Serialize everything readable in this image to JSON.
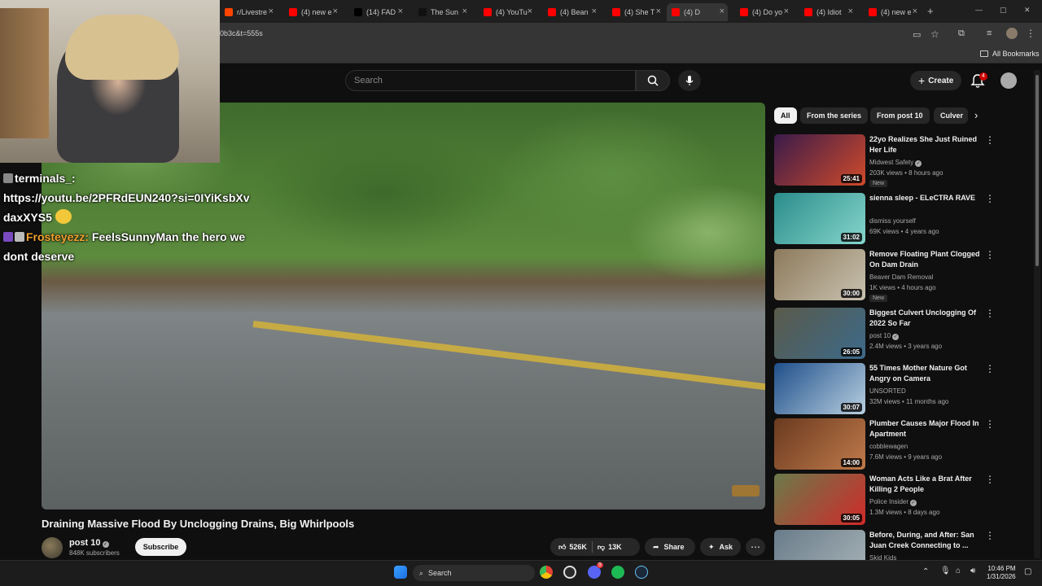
{
  "browser": {
    "tabs": [
      {
        "label": "r/Livestre",
        "color": "#ff4500"
      },
      {
        "label": "(4) new e",
        "color": "#ff0000"
      },
      {
        "label": "(14) FAD",
        "color": "#000000"
      },
      {
        "label": "The Sun",
        "color": "#111111"
      },
      {
        "label": "(4) YouTu",
        "color": "#ff0000"
      },
      {
        "label": "(4) Bean",
        "color": "#ff0000"
      },
      {
        "label": "(4) She T",
        "color": "#ff0000"
      },
      {
        "label": "(4) D",
        "color": "#ff0000"
      },
      {
        "label": "(4) Do yo",
        "color": "#ff0000"
      },
      {
        "label": "(4) Idiot",
        "color": "#ff0000"
      },
      {
        "label": "(4) new e",
        "color": "#ff0000"
      }
    ],
    "url": "0b3c&t=555s",
    "bookmarks_label": "All Bookmarks"
  },
  "youtube": {
    "search_placeholder": "Search",
    "create_label": "Create",
    "notification_count": "4"
  },
  "chat": {
    "messages": [
      {
        "user": "terminals_:",
        "text": "https://youtu.be/2PFRdEUN240?si=0IYiKsbXvdaxXYS5"
      },
      {
        "user": "Frosteyezz:",
        "text": "FeelsSunnyMan the hero we dont deserve"
      }
    ]
  },
  "video": {
    "title": "Draining Massive Flood By Unclogging Drains, Big Whirlpools",
    "channel": "post 10",
    "subscribers": "848K subscribers",
    "subscribe_label": "Subscribe",
    "likes": "526K",
    "dislikes": "13K",
    "share_label": "Share",
    "ask_label": "Ask",
    "watermark": "POST 10"
  },
  "chips": [
    "All",
    "From the series",
    "From post 10",
    "Culver"
  ],
  "recommendations": [
    {
      "title": "22yo Realizes She Just Ruined Her Life",
      "channel": "Midwest Safety",
      "verified": true,
      "meta": "203K views • 8 hours ago",
      "duration": "25:41",
      "new": "New",
      "thumb": [
        "#3a1b4a",
        "#d04a2a"
      ]
    },
    {
      "title": "sienna sleep - ELeCTRA RAVE",
      "channel": "dismiss yourself",
      "verified": false,
      "meta": "69K views • 4 years ago",
      "duration": "31:02",
      "new": "",
      "thumb": [
        "#2a8c8a",
        "#86d6cc"
      ]
    },
    {
      "title": "Remove Floating Plant Clogged On Dam Drain",
      "channel": "Beaver Dam Removal",
      "verified": false,
      "meta": "1K views • 4 hours ago",
      "duration": "30:00",
      "new": "New",
      "thumb": [
        "#8c7a5c",
        "#c9c2b0"
      ]
    },
    {
      "title": "Biggest Culvert Unclogging Of 2022 So Far",
      "channel": "post 10",
      "verified": true,
      "meta": "2.4M views • 3 years ago",
      "duration": "26:05",
      "new": "",
      "thumb": [
        "#5a5a4a",
        "#3c6a8a"
      ]
    },
    {
      "title": "55 Times Mother Nature Got Angry on Camera",
      "channel": "UNSORTED",
      "verified": false,
      "meta": "32M views • 11 months ago",
      "duration": "30:07",
      "new": "",
      "thumb": [
        "#1f4f8a",
        "#b8cfe0"
      ]
    },
    {
      "title": "Plumber Causes Major Flood In Apartment",
      "channel": "cobblewagen",
      "verified": false,
      "meta": "7.6M views • 9 years ago",
      "duration": "14:00",
      "new": "",
      "thumb": [
        "#6a3a20",
        "#c07a4a"
      ]
    },
    {
      "title": "Woman Acts Like a Brat After Killing 2 People",
      "channel": "Police Insider",
      "verified": true,
      "meta": "1.3M views • 8 days ago",
      "duration": "30:05",
      "new": "",
      "thumb": [
        "#6a7a4a",
        "#d02a2a"
      ]
    },
    {
      "title": "Before, During, and After: San Juan Creek Connecting to ...",
      "channel": "Skid Kids",
      "verified": false,
      "meta": "",
      "duration": "",
      "new": "",
      "thumb": [
        "#6a7c8a",
        "#a8b4b8"
      ]
    }
  ],
  "taskbar": {
    "search_label": "Search",
    "time": "10:46 PM",
    "date": "1/31/2026",
    "discord_badge": "9"
  }
}
